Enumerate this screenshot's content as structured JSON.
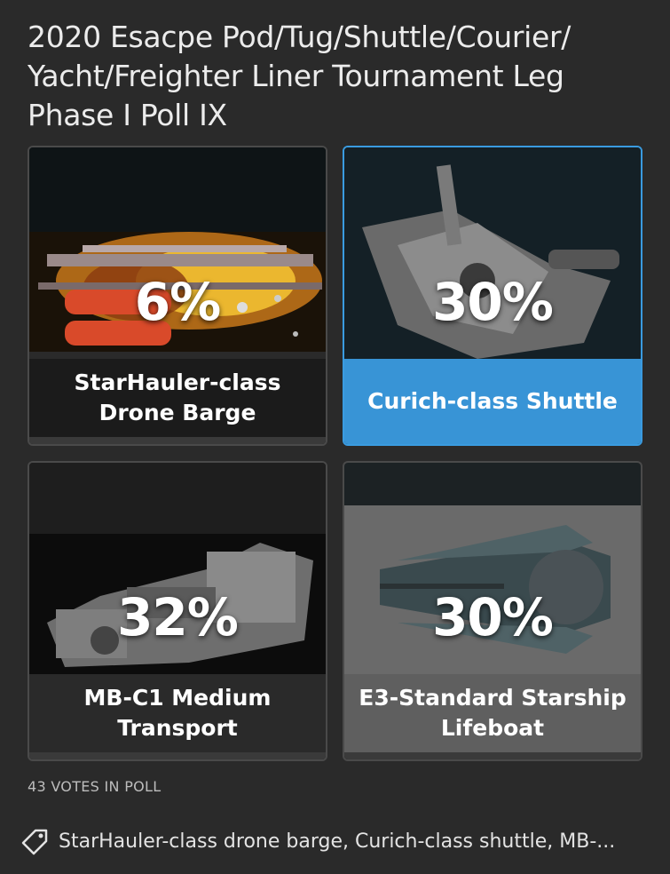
{
  "poll": {
    "title": "2020 Esacpe Pod/Tug/Shuttle/Courier/ Yacht/Freighter Liner Tournament Leg Phase I Poll IX",
    "votes_text": "43 VOTES IN POLL",
    "accent_color": "#3a9be0",
    "options": [
      {
        "label": "StarHauler-class Drone Barge",
        "percent_text": "6%",
        "percent": 6,
        "selected": false
      },
      {
        "label": "Curich-class Shuttle",
        "percent_text": "30%",
        "percent": 30,
        "selected": true
      },
      {
        "label": "MB-C1 Medium Transport",
        "percent_text": "32%",
        "percent": 32,
        "selected": false
      },
      {
        "label": "E3-Standard Starship Lifeboat",
        "percent_text": "30%",
        "percent": 30,
        "selected": false
      }
    ]
  },
  "tags": {
    "icon": "tag-icon",
    "text": "StarHauler-class drone barge, Curich-class shuttle, MB-..."
  }
}
